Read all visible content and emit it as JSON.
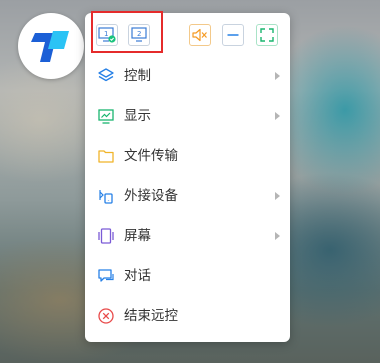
{
  "toolbar": {
    "monitor1": "1",
    "monitor2": "2"
  },
  "menu": {
    "items": [
      {
        "label": "控制",
        "icon": "layers-icon",
        "submenu": true
      },
      {
        "label": "显示",
        "icon": "display-icon",
        "submenu": true
      },
      {
        "label": "文件传输",
        "icon": "folder-icon",
        "submenu": false
      },
      {
        "label": "外接设备",
        "icon": "devices-icon",
        "submenu": true
      },
      {
        "label": "屏幕",
        "icon": "screen-icon",
        "submenu": true
      },
      {
        "label": "对话",
        "icon": "chat-icon",
        "submenu": false
      },
      {
        "label": "结束远控",
        "icon": "close-circle-icon",
        "submenu": false
      }
    ]
  },
  "colors": {
    "brand": "#1e9bff",
    "accent": "#2680e6",
    "orange": "#f59a23",
    "green": "#19c37d",
    "red": "#e84a4a",
    "highlight": "#e52b2b"
  }
}
